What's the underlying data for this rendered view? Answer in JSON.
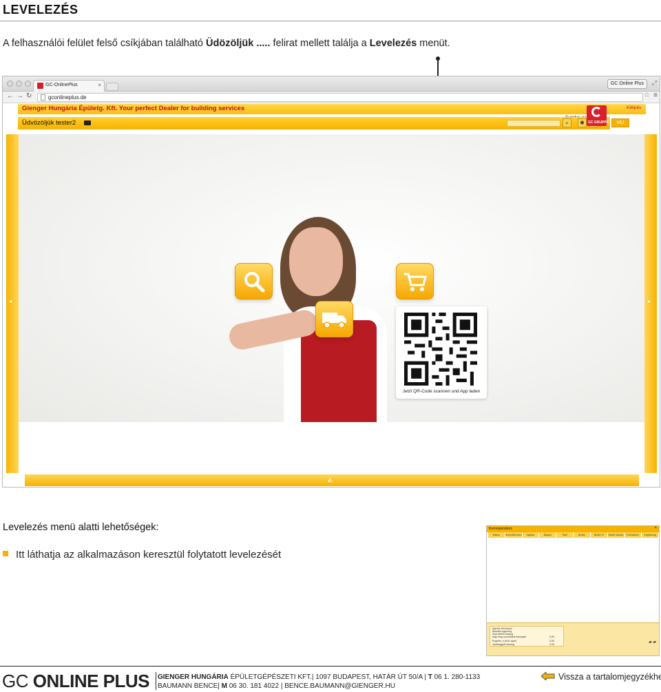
{
  "page": {
    "title": "LEVELEZÉS",
    "intro_before": "A felhasználói felület felső csíkjában található ",
    "intro_bold_1": "Üdözöljük .....",
    "intro_middle": " felirat mellett találja a ",
    "intro_bold_2": "Levelezés",
    "intro_after": " menüt."
  },
  "browser": {
    "tab_title": "GC-OnlinePlus",
    "tab_close": "×",
    "profile_button": "GC Online Plus",
    "url": "gconlineplus.de"
  },
  "site": {
    "dealer_text": "Gienger Hungária Épületg. Kft. Your perfect Dealer for building services",
    "welcome_text": "Üdvözöljük tester2",
    "surplus_text": "Surplus value from",
    "logout": "Kilépés",
    "lang": "HU",
    "logo_text": "GC GRUPPE",
    "help_btn": "?",
    "qr_caption": "Jetzt QR-Code scannen und App laden"
  },
  "tiles": {
    "search_icon": "search-icon",
    "cart_icon": "cart-icon",
    "truck_icon": "truck-icon"
  },
  "section": {
    "title": "Levelezés menü alatti lehetőségek:",
    "bullet_1": "Itt láthatja az alkalmazáson keresztül folytatott levelezését"
  },
  "mini_screenshot": {
    "title": "Korrespondenz",
    "columns": [
      "Dátum",
      "Szerződő személy",
      "Ajánlat",
      "Állapot",
      "Tétel",
      "Bruttó",
      "Bruttó %",
      "Bruttó összeg",
      "Devizanem",
      "Végösszeg"
    ],
    "panel_rows": [
      {
        "label": "Ajánlat információ",
        "value": ""
      },
      {
        "label": "Aktuális egyenleg",
        "value": ""
      },
      {
        "label": "Szerződési összeg",
        "value": ""
      },
      {
        "label": "Adja meg szerződési összegét",
        "value": "0,00"
      },
      {
        "label": "Engedm. a fizet. Ajánl.",
        "value": "0,00"
      },
      {
        "label": "Jóváhagyott összeg",
        "value": "0,00"
      }
    ]
  },
  "footer": {
    "brand_gc": "GC",
    "brand_op": "ONLINE PLUS",
    "company_bold": "GIENGER HUNGÁRIA",
    "company_rest": " ÉPÜLETGÉPÉSZETI KFT.| 1097 BUDAPEST, HATÁR ÚT 50/A | ",
    "phone_label": "T",
    "phone": " 06 1. 280-1133",
    "line2_name": "BAUMANN BENCE| ",
    "mobile_label": "M",
    "mobile": " 06 30. 181 4022 | BENCE.BAUMANN@GIENGER.HU",
    "back_link": "Vissza a tartalomjegyzékhez"
  },
  "colors": {
    "accent_yellow": "#f7b200",
    "brand_red": "#d9202b",
    "text_dark": "#222222"
  }
}
